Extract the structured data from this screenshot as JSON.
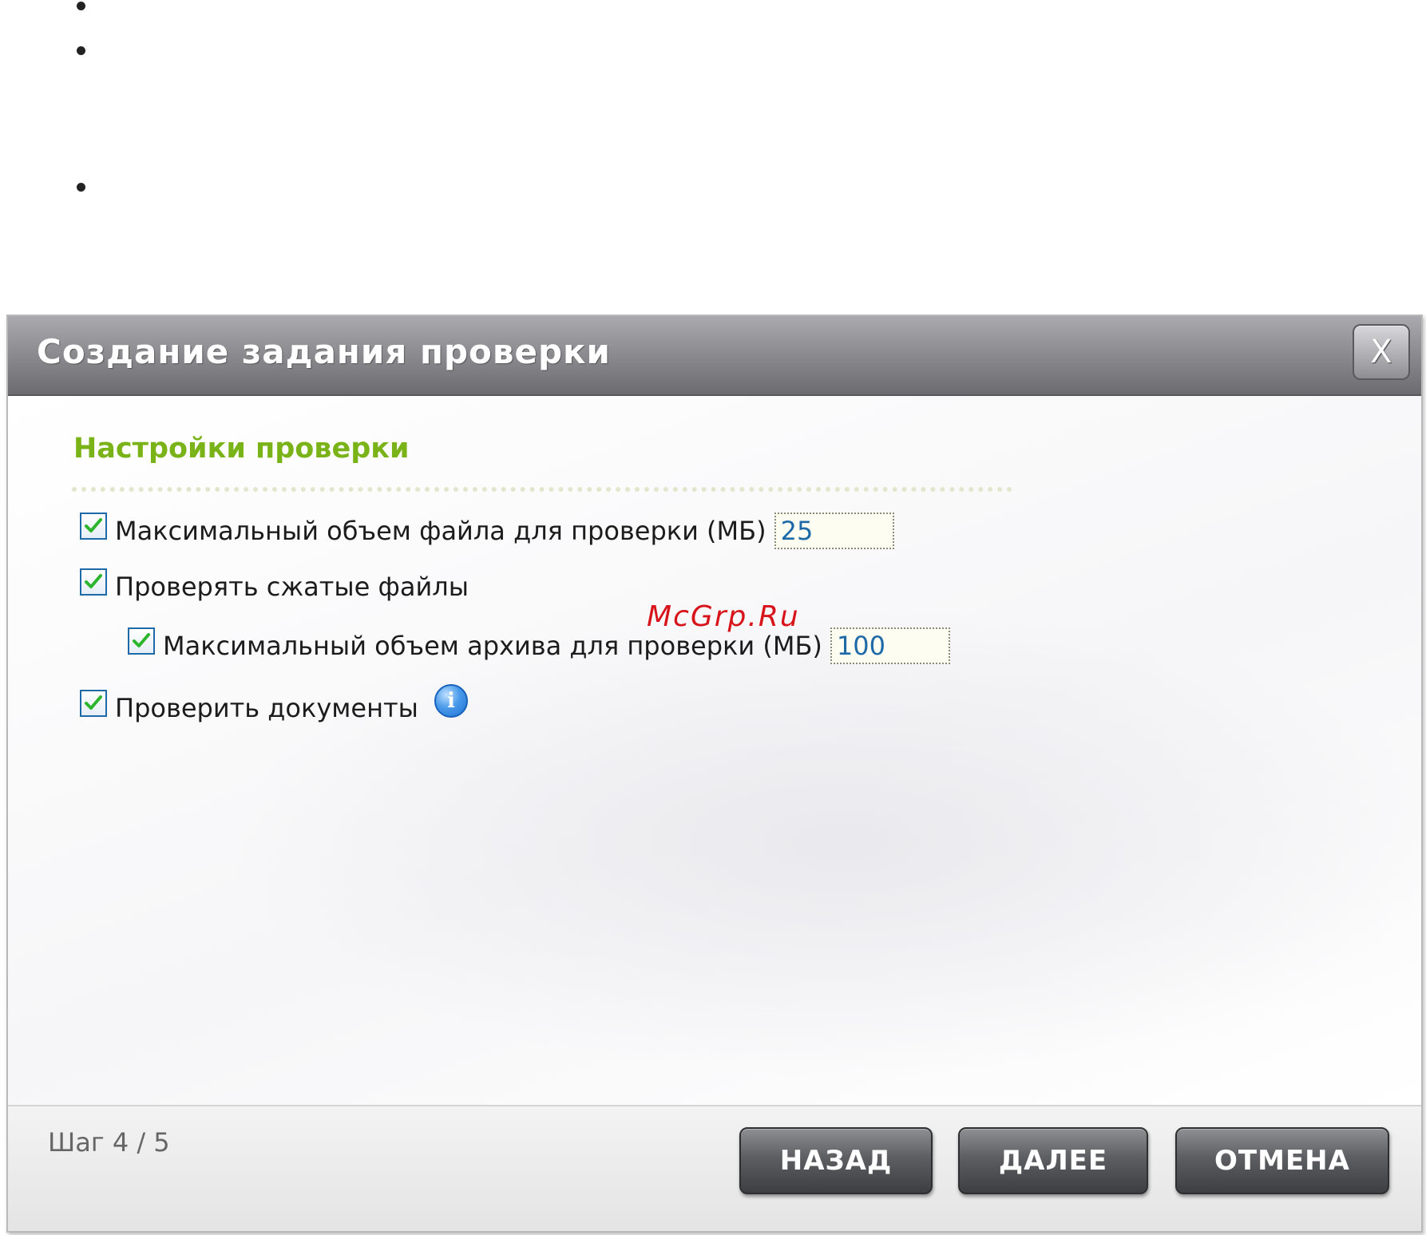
{
  "dialog": {
    "title": "Создание задания проверки",
    "close_label": "X"
  },
  "section": {
    "title": "Настройки проверки"
  },
  "options": {
    "max_file_size": {
      "label": "Максимальный объем файла для проверки (МБ)",
      "value": "25",
      "checked": true
    },
    "scan_compressed": {
      "label": "Проверять сжатые файлы",
      "checked": true
    },
    "max_archive_size": {
      "label": "Максимальный объем архива для проверки (МБ)",
      "value": "100",
      "checked": true
    },
    "scan_documents": {
      "label": "Проверить документы",
      "checked": true
    }
  },
  "watermark": "McGrp.Ru",
  "footer": {
    "step": "Шаг 4 / 5",
    "back_label": "НАЗАД",
    "next_label": "ДАЛЕЕ",
    "cancel_label": "ОТМЕНА"
  },
  "colors": {
    "section_title": "#7ab318",
    "checkbox_border": "#1e6aa8",
    "check_mark": "#2db52d",
    "input_text": "#1e6aa8",
    "watermark": "#d8141b"
  },
  "icons": {
    "check": "check-icon",
    "info": "info-icon",
    "close": "close-icon"
  }
}
